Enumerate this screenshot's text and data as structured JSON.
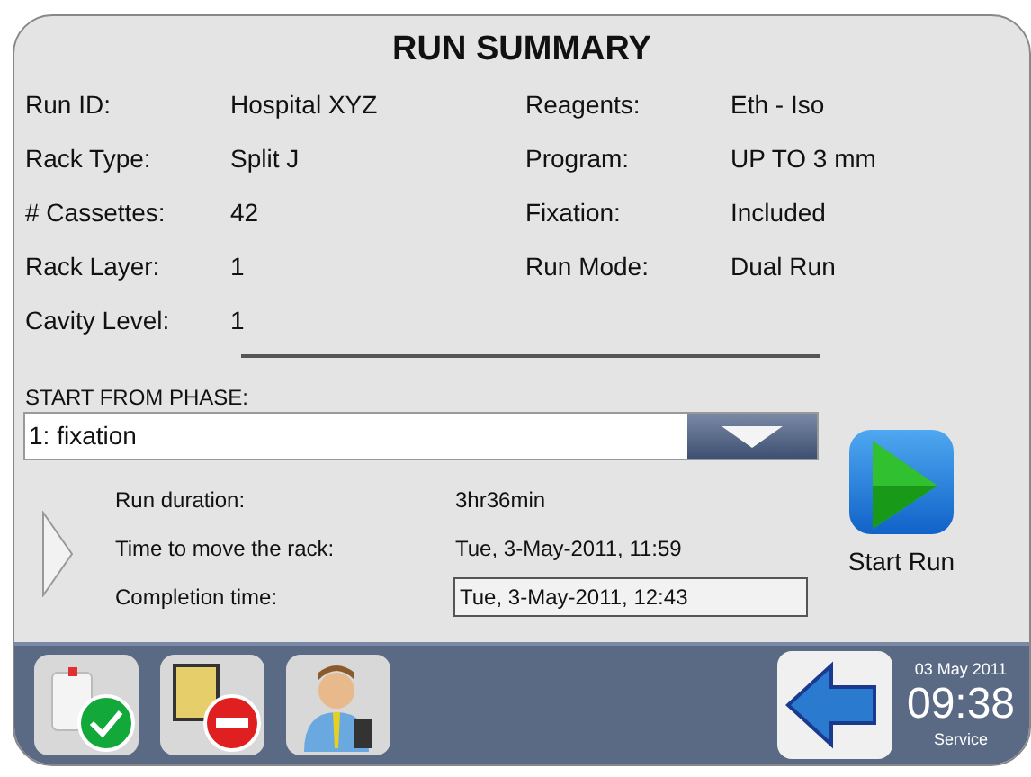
{
  "title": "RUN SUMMARY",
  "summary_left": [
    {
      "label": "Run ID:",
      "value": "Hospital XYZ"
    },
    {
      "label": "Rack Type:",
      "value": "Split J"
    },
    {
      "label": "# Cassettes:",
      "value": "42"
    },
    {
      "label": "Rack Layer:",
      "value": "1"
    },
    {
      "label": "Cavity Level:",
      "value": "1"
    }
  ],
  "summary_right": [
    {
      "label": "Reagents:",
      "value": "Eth - Iso"
    },
    {
      "label": "Program:",
      "value": "UP TO 3 mm"
    },
    {
      "label": "Fixation:",
      "value": "Included"
    },
    {
      "label": "Run Mode:",
      "value": "Dual Run"
    }
  ],
  "phase": {
    "label": "START FROM PHASE:",
    "value": "1: fixation"
  },
  "timing": [
    {
      "label": "Run duration:",
      "value": "3hr36min",
      "kind": "plain"
    },
    {
      "label": "Time to move the rack:",
      "value": "Tue, 3-May-2011, 11:59",
      "kind": "plain"
    },
    {
      "label": "Completion time:",
      "value": "Tue, 3-May-2011, 12:43",
      "kind": "boxed"
    }
  ],
  "start_button": {
    "label": "Start Run"
  },
  "status": {
    "date": "03 May 2011",
    "time": "09:38",
    "mode": "Service"
  }
}
